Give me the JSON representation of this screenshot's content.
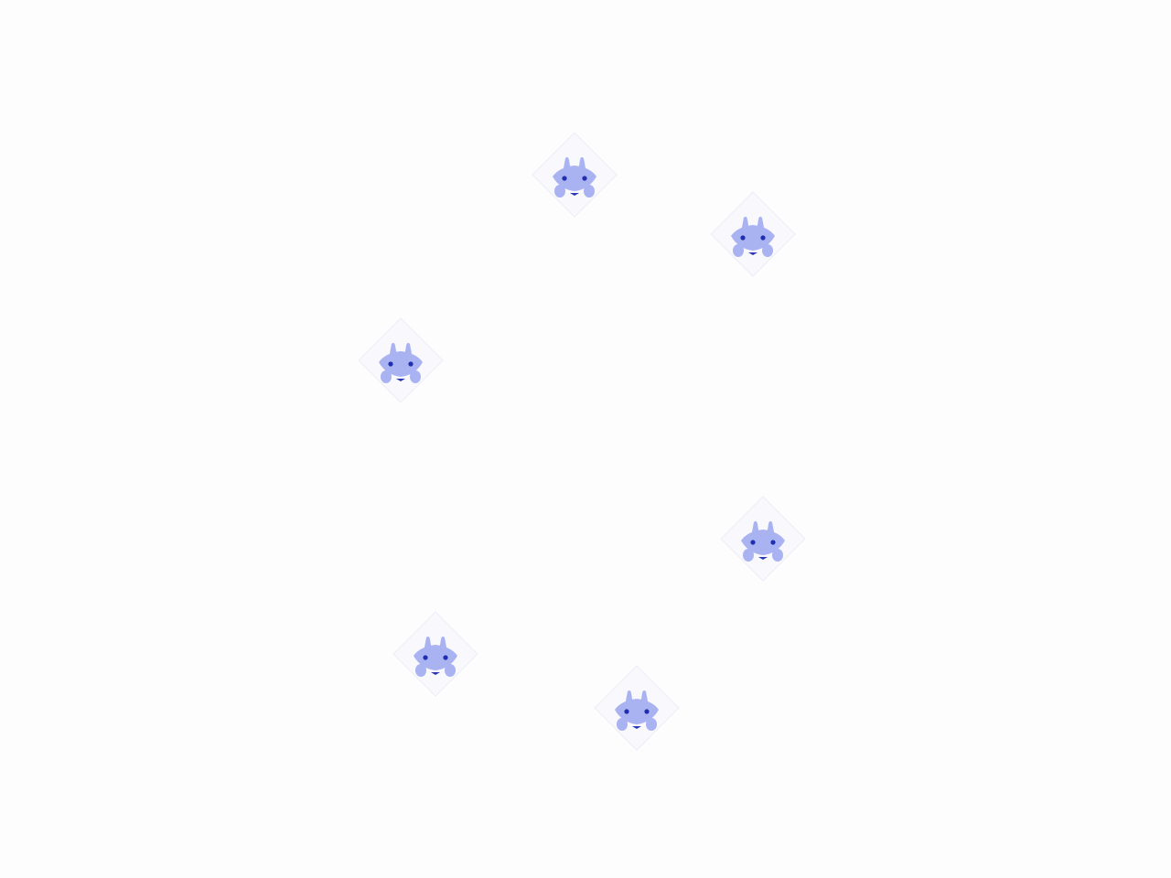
{
  "scene": {
    "background_color": "#fdfdfe",
    "sprite_icon": "bunny-creature-icon",
    "sprite_count": 6,
    "colors": {
      "tile_fill": "#f8f8fd",
      "tile_edge": "#eeeef8",
      "body": "#aab3f2",
      "eyes": "#1f2fb0",
      "mouth": "#2a38b8"
    }
  }
}
